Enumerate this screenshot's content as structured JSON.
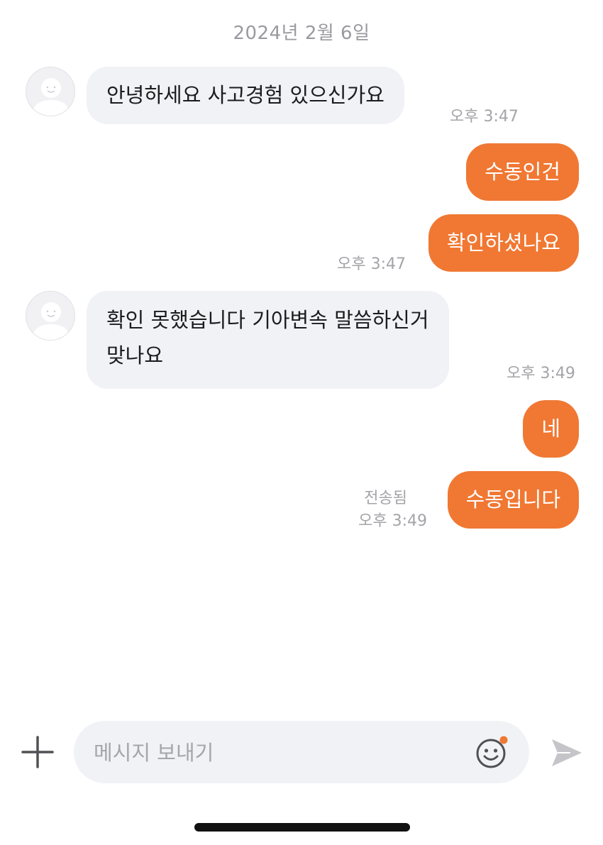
{
  "chat": {
    "date": "2024년 2월 6일",
    "messages": [
      {
        "sender": "them",
        "text": "안녕하세요  사고경험 있으신가요",
        "time": "오후 3:47"
      },
      {
        "sender": "me",
        "text": "수동인건"
      },
      {
        "sender": "me",
        "text": "확인하셨나요",
        "time": "오후 3:47"
      },
      {
        "sender": "them",
        "lines": [
          "확인 못했습니다  기아변속 말씀하신거",
          "맞나요"
        ],
        "time": "오후 3:49"
      },
      {
        "sender": "me",
        "text": "네"
      },
      {
        "sender": "me",
        "text": "수동입니다",
        "status": "전송됨",
        "time": "오후 3:49"
      }
    ]
  },
  "composer": {
    "placeholder": "메시지 보내기",
    "plus_icon": "plus-icon",
    "emoji_icon": "smiley-icon",
    "send_icon": "send-icon",
    "notification_dot_color": "#f07833"
  },
  "theme": {
    "outgoing_bubble": "#f07833",
    "incoming_bubble": "#f1f2f6"
  }
}
